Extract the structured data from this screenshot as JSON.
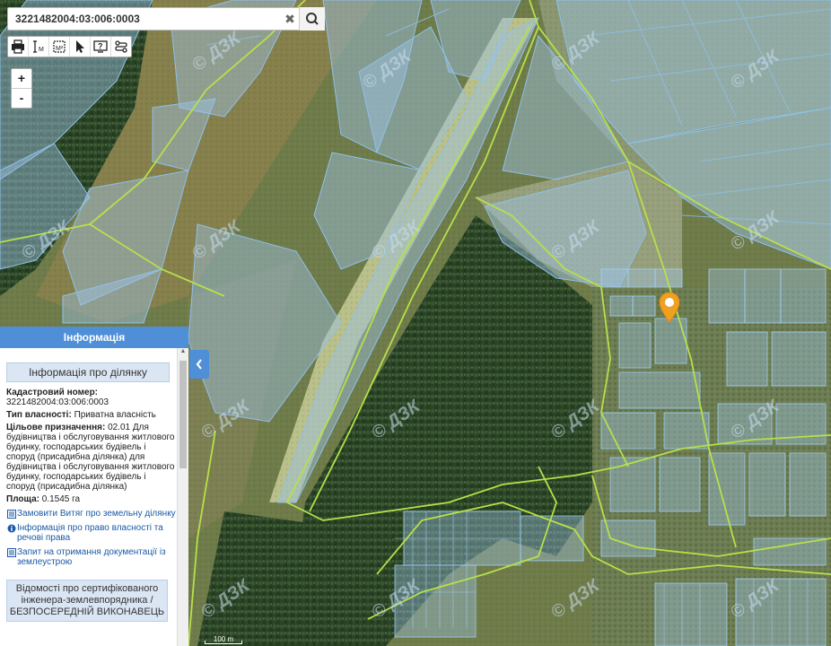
{
  "search": {
    "value": "3221482004:03:006:0003",
    "clear_icon": "close-icon",
    "go_icon": "search-icon"
  },
  "toolbar": {
    "tools": [
      "print-icon",
      "measure-line-icon",
      "measure-area-icon",
      "pointer-icon",
      "info-icon",
      "layers-icon"
    ]
  },
  "zoom": {
    "in_label": "+",
    "out_label": "-"
  },
  "panel": {
    "header": "Інформація",
    "section_title": "Інформація про ділянку",
    "cadastral_label": "Кадастровий номер:",
    "cadastral_value": "3221482004:03:006:0003",
    "ownership_label": "Тип власності:",
    "ownership_value": "Приватна власність",
    "purpose_label": "Цільове призначення:",
    "purpose_value": "02.01 Для будівництва і обслуговування житлового будинку, господарських будівель і споруд (присадибна ділянка) для будівництва і обслуговування житлового будинку, господарських будівель і споруд (присадибна ділянка)",
    "area_label": "Площа:",
    "area_value": "0.1545 га",
    "link1": "Замовити Витяг про земельну ділянку",
    "link2": "Інформація про право власності та речові права",
    "link3": "Запит на отримання документації із землеустрою",
    "section2": "Відомості про сертифікованого інженера-землевпорядника / БЕЗПОСЕРЕДНІЙ ВИКОНАВЕЦЬ"
  },
  "map": {
    "watermark": "© ДЗК",
    "scale_label": "100 m",
    "colors": {
      "parcel_fill": "#9ec3e6",
      "parcel_stroke": "#8fc0ea",
      "boundary": "#b7e04a",
      "forest": "#2f4a2a",
      "field": "#7a7a45",
      "marker": "#f0a020",
      "panel_header": "#4f8fd8"
    }
  }
}
